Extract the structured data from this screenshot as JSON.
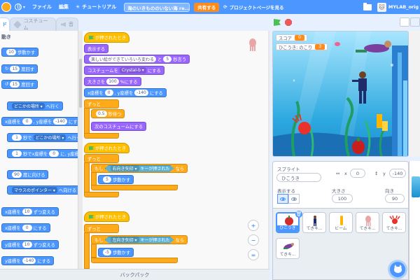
{
  "menu": {
    "file": "ファイル",
    "edit": "編集",
    "tutorial": "チュートリアル",
    "project_title": "海のいきもののいない海 re...",
    "share": "共有する",
    "see_project_page": "プロジェクトページを見る",
    "username": "MYLAB_orig"
  },
  "tabs": {
    "code": "ド",
    "costume": "コスチューム",
    "sound": "音"
  },
  "palette": {
    "category": "動き",
    "blocks": [
      {
        "pre": "",
        "input": "10",
        "post": "歩動かす"
      },
      {
        "pre": "↻",
        "input": "15",
        "post": "度回す"
      },
      {
        "pre": "↺",
        "input": "15",
        "post": "度回す"
      },
      {
        "pre": "",
        "dropdown": "どこかの場所 ▾",
        "post": "へ行く"
      },
      {
        "pre": "x座標を",
        "input": "0",
        "mid": ", y座標を",
        "input2": "-140",
        "post": "にする"
      },
      {
        "pre": "",
        "input": "1",
        "mid": "秒で",
        "dropdown": "どこかの場所 ▾",
        "post": "へ行く"
      },
      {
        "pre": "",
        "input": "1",
        "mid": "秒でx座標を",
        "input2": "0",
        "post": "に, y座標を"
      },
      {
        "pre": "",
        "input": "90",
        "post": "度に向ける"
      },
      {
        "pre": "",
        "dropdown": "マウスのポインター ▾",
        "post": "へ向ける"
      },
      {
        "pre": "x座標を",
        "input": "10",
        "post": "ずつ変える"
      },
      {
        "pre": "x座標を",
        "input": "0",
        "post": "にする"
      },
      {
        "pre": "y座標を",
        "input": "10",
        "post": "ずつ変える"
      },
      {
        "pre": "y座標を",
        "input": "-140",
        "post": "にする"
      }
    ]
  },
  "script1": {
    "hat": "が押されたとき",
    "show": "表示する",
    "say_text": "楽しい絵ができていろいろ変わる",
    "say_and": "と",
    "say_secs": "5",
    "say_post": "秒言う",
    "costume_pre": "コスチュームを",
    "costume_val": "Crystal-b ▾",
    "costume_post": "にする",
    "size_pre": "大きさを",
    "size_val": "100",
    "size_post": "%にする",
    "goto_pre": "x座標を",
    "goto_x": "0",
    "goto_mid": ", y座標を",
    "goto_y": "-140",
    "goto_post": "にする",
    "forever": "ずっと",
    "wait_val": "0.5",
    "wait_post": "秒待つ",
    "next_costume": "次のコスチュームにする"
  },
  "script2": {
    "hat": "が押されたとき",
    "forever": "ずっと",
    "if": "もし",
    "key": "右向き矢印 ▾",
    "key_post": "キーが押された",
    "then": "なら",
    "move_val": "5",
    "move_post": "歩動かす"
  },
  "script3": {
    "hat": "が押されたとき",
    "forever": "ずっと",
    "if": "もし",
    "key": "左向き矢印 ▾",
    "key_post": "キーが押された",
    "then": "なら",
    "move_val": "-5",
    "move_post": "歩動かす"
  },
  "zoom": {
    "in": "+",
    "out": "−",
    "reset": "="
  },
  "backpack": "バックパック",
  "stage": {
    "score_label": "スコア",
    "score_value": "0",
    "var_label": "ひこうき: のこり",
    "var_value": "3"
  },
  "sprite_info": {
    "sprite_label": "スプライト",
    "sprite_name": "ひこうき",
    "x_label": "x",
    "x_value": "0",
    "y_label": "y",
    "y_value": "-140",
    "show_label": "表示する",
    "size_label": "大きさ",
    "size_value": "100",
    "direction_label": "向き",
    "direction_value": "90"
  },
  "sprites": [
    {
      "name": "ひこうき",
      "selected": true
    },
    {
      "name": "てきキ...",
      "selected": false
    },
    {
      "name": "ビーム",
      "selected": false
    },
    {
      "name": "てきキ...",
      "selected": false
    },
    {
      "name": "てきキ...",
      "selected": false
    },
    {
      "name": "てきキ...",
      "selected": false
    },
    {
      "name": "てきキ...",
      "selected": false
    }
  ],
  "colors": {
    "menu_bar": "#4c97ff",
    "motion": "#4c97ff",
    "events": "#ffbf00",
    "control": "#ffab19",
    "looks": "#9966ff",
    "sensing": "#5cb1d6",
    "share": "#ff8c1a"
  }
}
